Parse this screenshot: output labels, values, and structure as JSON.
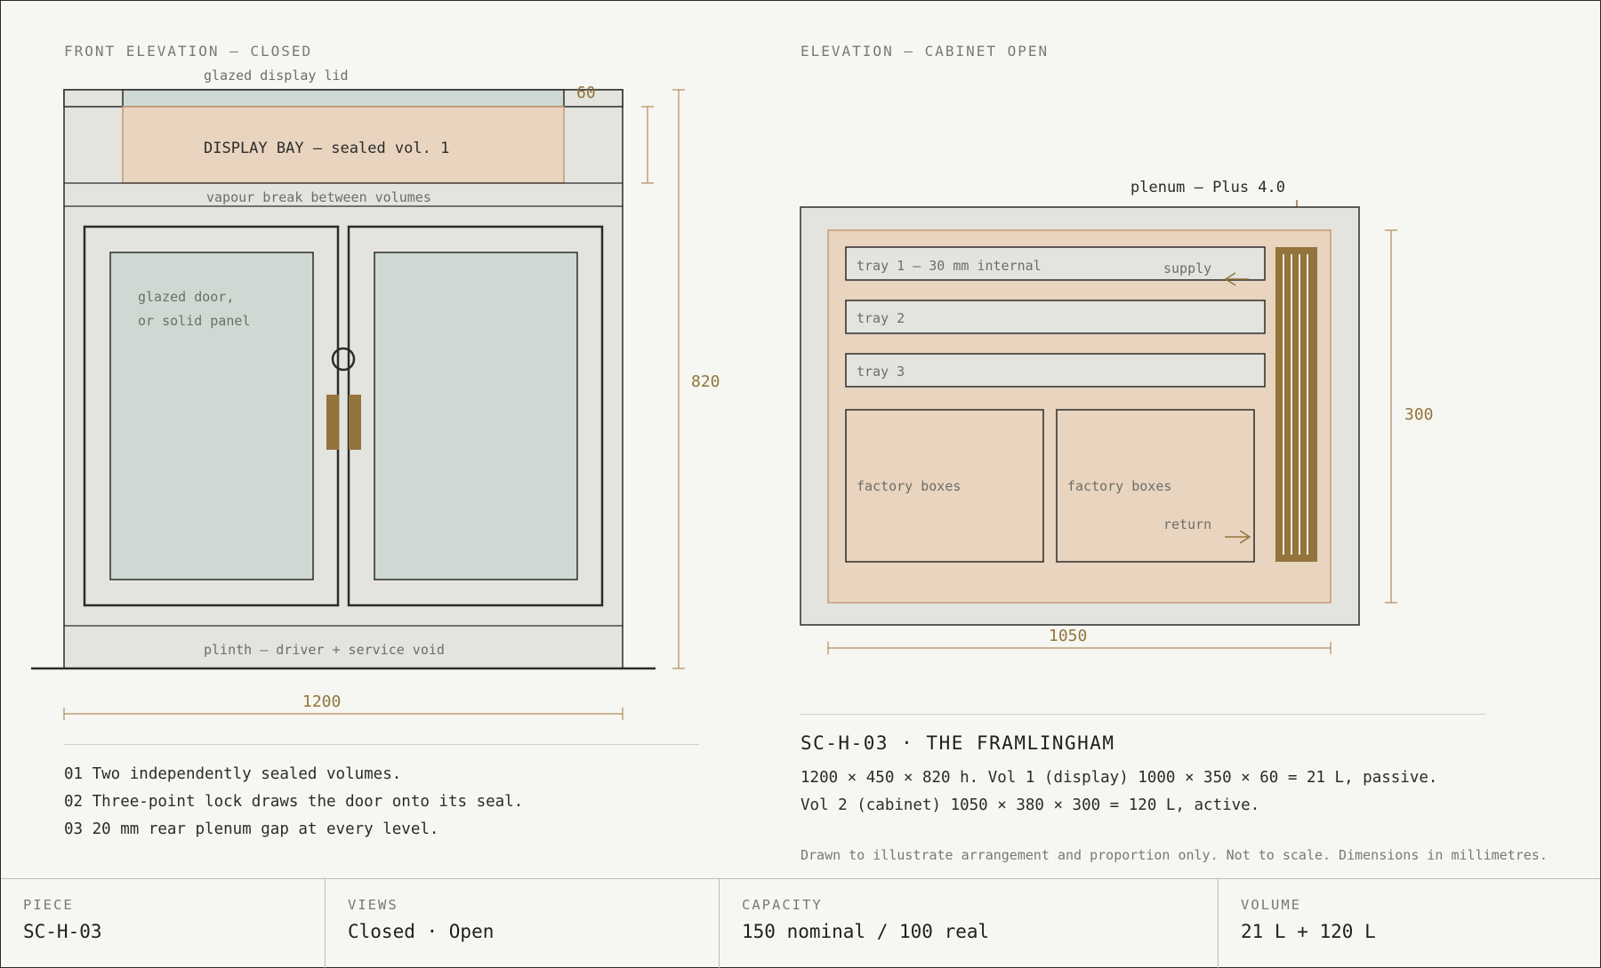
{
  "left_view": {
    "title": "FRONT ELEVATION — CLOSED",
    "lid_label": "glazed display lid",
    "bay_label": "DISPLAY BAY — sealed vol. 1",
    "vapour_label": "vapour break between volumes",
    "door_note_1": "glazed door,",
    "door_note_2": "or solid panel",
    "plinth_label": "plinth — driver + service void",
    "dim_lid": "60",
    "dim_height": "820",
    "dim_width": "1200"
  },
  "right_view": {
    "title": "ELEVATION — CABINET OPEN",
    "plenum_label": "plenum — Plus 4.0",
    "tray1": "tray 1 — 30 mm internal",
    "supply": "supply",
    "tray2": "tray 2",
    "tray3": "tray 3",
    "box1": "factory boxes",
    "box2": "factory boxes",
    "return": "return",
    "dim_height": "300",
    "dim_width": "1050"
  },
  "notes": [
    "01 Two independently sealed volumes.",
    "02 Three-point lock draws the door onto its seal.",
    "03 20 mm rear plenum gap at every level."
  ],
  "spec": {
    "title": "SC-H-03 · THE FRAMLINGHAM",
    "line1": "1200 × 450 × 820 h. Vol 1 (display) 1000 × 350 × 60 = 21 L, passive.",
    "line2": "Vol 2 (cabinet) 1050 × 380 × 300 = 120 L, active.",
    "disclaimer": "Drawn to illustrate arrangement and proportion only. Not to scale. Dimensions in millimetres."
  },
  "footer": [
    {
      "key": "PIECE",
      "value": "SC-H-03"
    },
    {
      "key": "VIEWS",
      "value": "Closed · Open"
    },
    {
      "key": "CAPACITY",
      "value": "150 nominal / 100 real"
    },
    {
      "key": "VOLUME",
      "value": "21 L + 120 L"
    }
  ],
  "colors": {
    "background": "#f6f6f2",
    "panel": "#e4e4de",
    "glass": "#cfd9d3",
    "cedar": "#e8d4bf",
    "accent": "#93743c",
    "line": "#2b2b2b"
  }
}
